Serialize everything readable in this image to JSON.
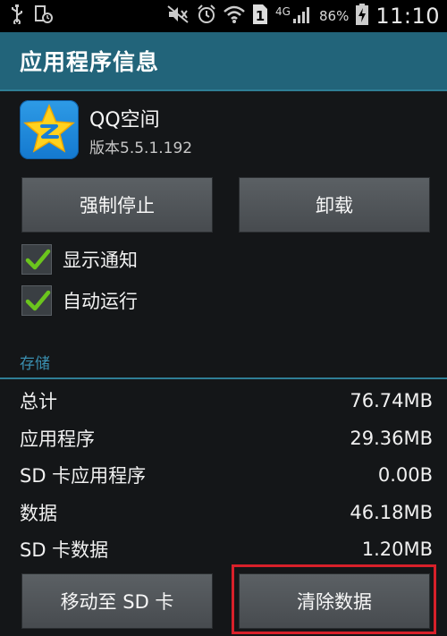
{
  "status_bar": {
    "network_type": "4G",
    "battery_percent": "86%",
    "time": "11:10",
    "sim_slot": "1",
    "icons": [
      "usb-icon",
      "location-settings-icon",
      "mute-icon",
      "alarm-icon",
      "wifi-icon",
      "sim-icon",
      "signal-icon",
      "battery-charging-icon"
    ]
  },
  "title_bar": {
    "title": "应用程序信息"
  },
  "app": {
    "name": "QQ空间",
    "version": "版本5.5.1.192",
    "icon": "qzone-star-icon"
  },
  "buttons": {
    "force_stop": "强制停止",
    "uninstall": "卸载",
    "move_to_sd": "移动至 SD 卡",
    "clear_data": "清除数据"
  },
  "checkboxes": [
    {
      "label": "显示通知",
      "checked": true
    },
    {
      "label": "自动运行",
      "checked": true
    }
  ],
  "storage": {
    "header": "存储",
    "rows": [
      {
        "label": "总计",
        "value": "76.74MB"
      },
      {
        "label": "应用程序",
        "value": "29.36MB"
      },
      {
        "label": "SD 卡应用程序",
        "value": "0.00B"
      },
      {
        "label": "数据",
        "value": "46.18MB"
      },
      {
        "label": "SD 卡数据",
        "value": "1.20MB"
      }
    ]
  },
  "colors": {
    "title_bar": "#22647a",
    "accent": "#2f7e95",
    "checkmark": "#6bc51d",
    "highlight": "#d8202a"
  }
}
